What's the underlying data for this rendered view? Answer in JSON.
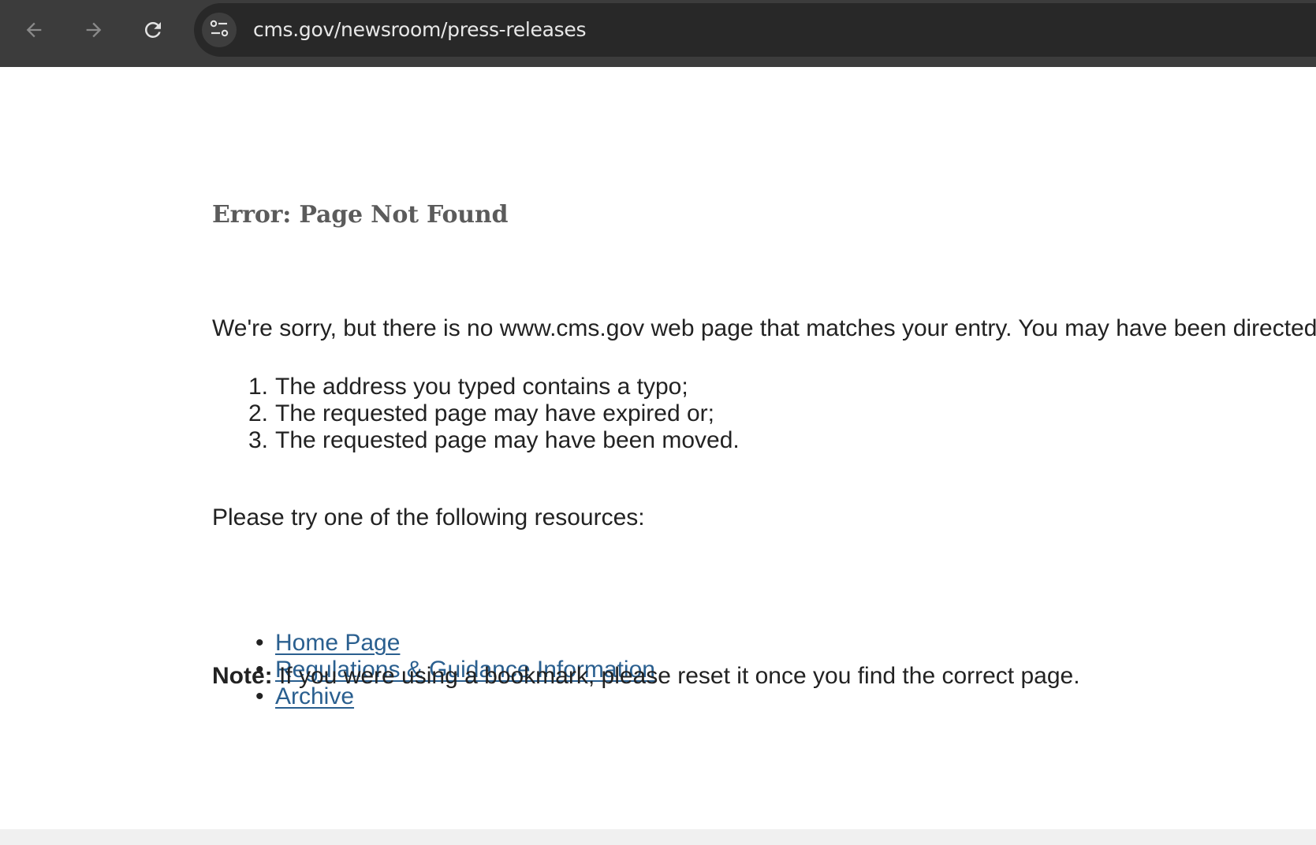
{
  "browser": {
    "url": "cms.gov/newsroom/press-releases",
    "icons": {
      "back": "arrow-left-icon",
      "forward": "arrow-right-icon",
      "reload": "reload-icon",
      "site_info": "tune-icon"
    },
    "colors": {
      "toolbar": "#3c3c3c",
      "omnibox": "#282828",
      "url_text": "#e8e8e8"
    }
  },
  "page": {
    "title": "Error: Page Not Found",
    "intro": "We're sorry, but there is no www.cms.gov web page that matches your entry. You may have been directed",
    "reasons": [
      {
        "num": "1.",
        "text": "The address you typed contains a typo;"
      },
      {
        "num": "2.",
        "text": "The requested page may have expired or;"
      },
      {
        "num": "3.",
        "text": "The requested page may have been moved."
      }
    ],
    "resources_intro": "Please try one of the following resources:",
    "resources": [
      {
        "bullet": "•",
        "label": "Home Page"
      },
      {
        "bullet": "•",
        "label": "Regulations & Guidance Information"
      },
      {
        "bullet": "•",
        "label": "Archive"
      }
    ],
    "note_label": "Note:",
    "note_text": " If you were using a bookmark, please reset it once you find the correct page.",
    "colors": {
      "title": "#5b5b5b",
      "body_text": "#222222",
      "link": "#2a5f8f"
    }
  }
}
